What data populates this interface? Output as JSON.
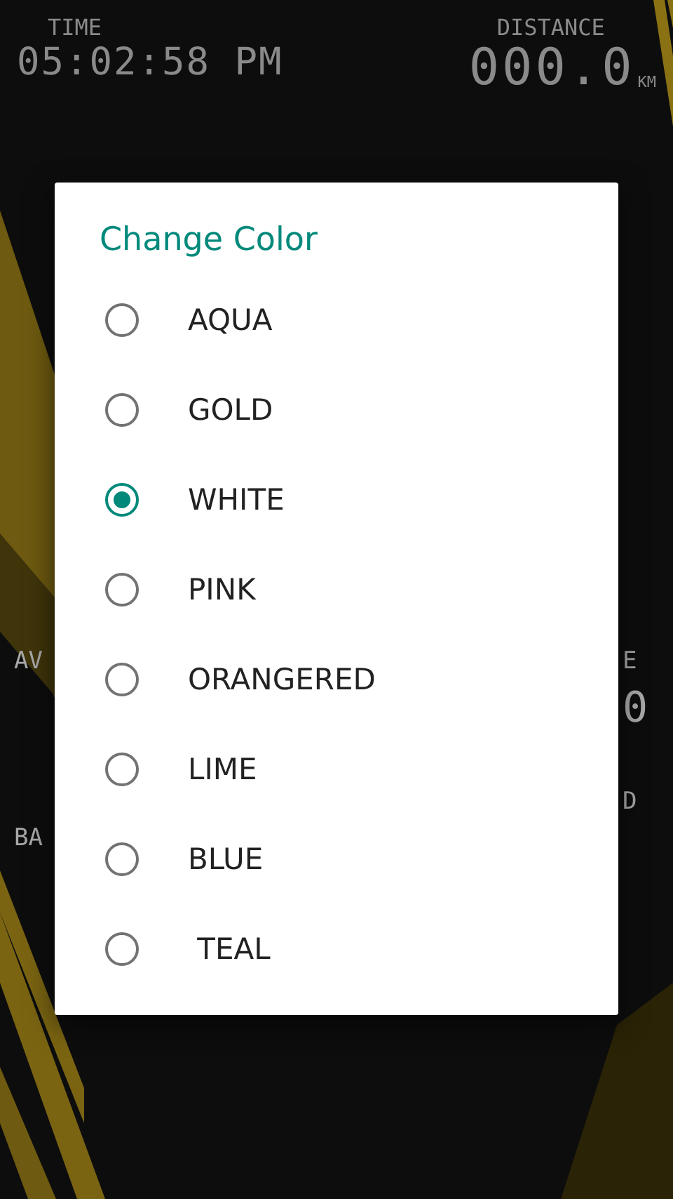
{
  "dashboard": {
    "time_label": "TIME",
    "time_value": "05:02:58 PM",
    "distance_label": "DISTANCE",
    "distance_value": "000.0",
    "distance_unit": "KM",
    "left_labels": [
      "AV",
      "BA"
    ],
    "right_labels": [
      "E",
      "0",
      "D"
    ]
  },
  "dialog": {
    "title": "Change Color",
    "options": [
      {
        "label": "AQUA",
        "selected": false
      },
      {
        "label": "GOLD",
        "selected": false
      },
      {
        "label": "WHITE",
        "selected": true
      },
      {
        "label": "PINK",
        "selected": false
      },
      {
        "label": "ORANGERED",
        "selected": false
      },
      {
        "label": "LIME",
        "selected": false
      },
      {
        "label": "BLUE",
        "selected": false
      },
      {
        "label": " TEAL",
        "selected": false
      }
    ]
  }
}
